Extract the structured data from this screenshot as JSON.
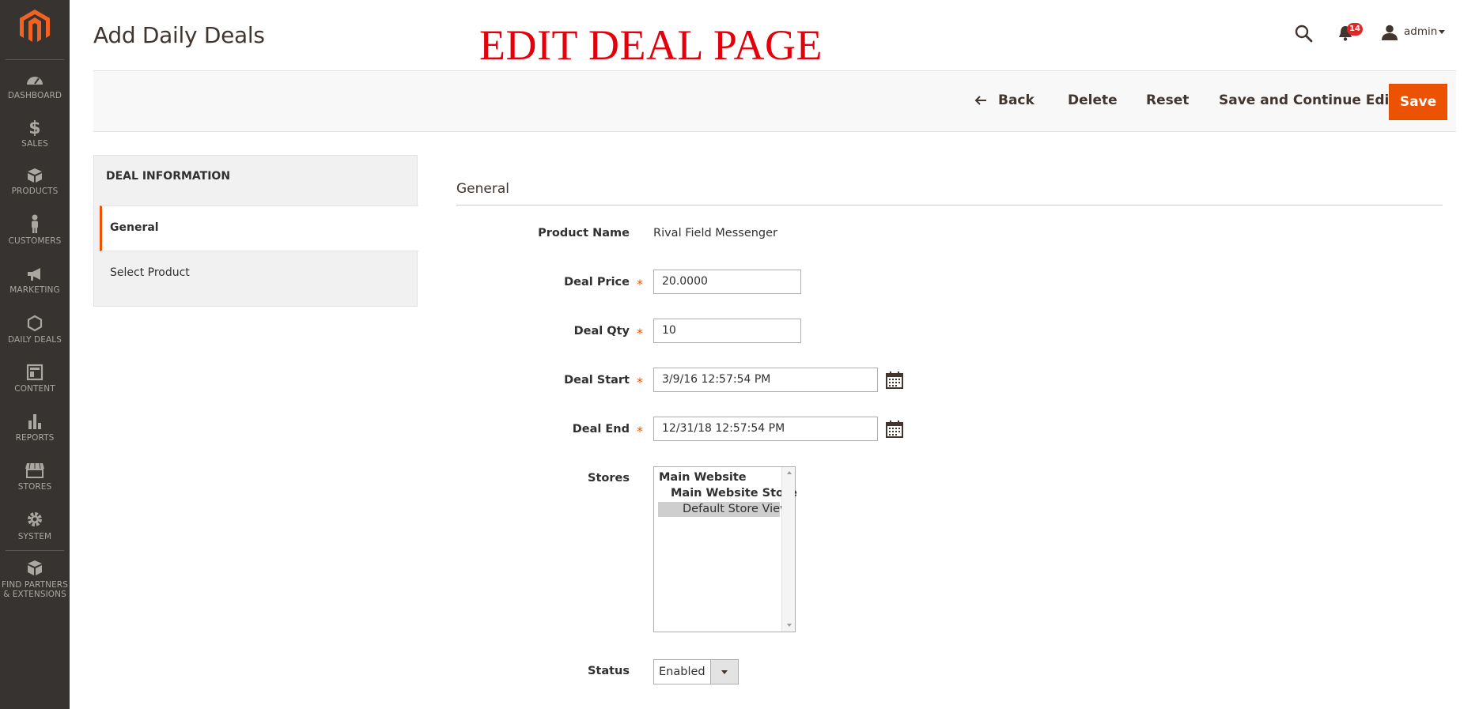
{
  "app": {
    "page_title": "Add Daily Deals",
    "overlay_caption": "EDIT DEAL PAGE",
    "accent_color": "#eb5202",
    "caption_color": "#e3000b"
  },
  "menu": {
    "items": [
      {
        "label": "DASHBOARD",
        "icon": "dashboard-icon"
      },
      {
        "label": "SALES",
        "icon": "dollar-icon"
      },
      {
        "label": "PRODUCTS",
        "icon": "cube-icon"
      },
      {
        "label": "CUSTOMERS",
        "icon": "person-icon"
      },
      {
        "label": "MARKETING",
        "icon": "megaphone-icon"
      },
      {
        "label": "DAILY DEALS",
        "icon": "hexagon-icon"
      },
      {
        "label": "CONTENT",
        "icon": "layout-icon"
      },
      {
        "label": "REPORTS",
        "icon": "bar-chart-icon"
      },
      {
        "label": "STORES",
        "icon": "store-icon"
      },
      {
        "label": "SYSTEM",
        "icon": "gear-icon"
      },
      {
        "label": "FIND PARTNERS",
        "label2": "& EXTENSIONS",
        "icon": "boxes-icon"
      }
    ]
  },
  "header": {
    "notification_count": "14",
    "user_name": "admin"
  },
  "actions": {
    "back": "Back",
    "delete": "Delete",
    "reset": "Reset",
    "save_continue": "Save and Continue Edit",
    "save": "Save"
  },
  "tabs": {
    "title": "DEAL INFORMATION",
    "items": [
      "General",
      "Select Product"
    ]
  },
  "form": {
    "section_title": "General",
    "product_name_label": "Product Name",
    "product_name_value": "Rival Field Messenger",
    "deal_price_label": "Deal Price",
    "deal_price_value": "20.0000",
    "deal_qty_label": "Deal Qty",
    "deal_qty_value": "10",
    "deal_start_label": "Deal Start",
    "deal_start_value": "3/9/16 12:57:54 PM",
    "deal_end_label": "Deal End",
    "deal_end_value": "12/31/18 12:57:54 PM",
    "stores_label": "Stores",
    "stores_options": [
      "Main Website",
      "Main Website Store",
      "Default Store View"
    ],
    "stores_selected": "Default Store View",
    "status_label": "Status",
    "status_value": "Enabled",
    "required_mark": "*"
  }
}
